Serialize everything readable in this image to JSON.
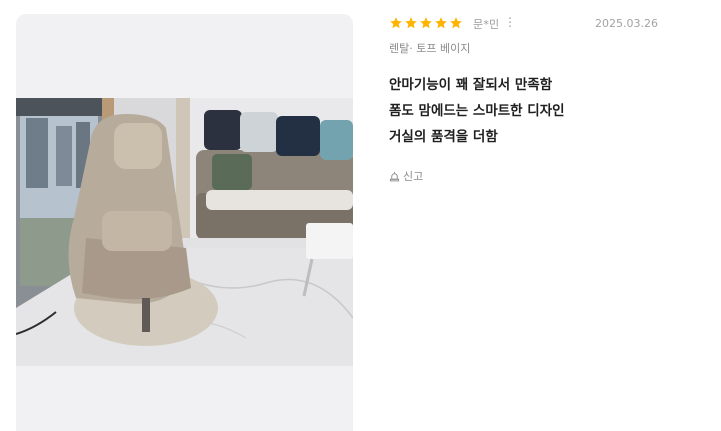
{
  "review": {
    "rating": 5,
    "rating_max": 5,
    "author": "문*민",
    "more_label": "⋮",
    "date": "2025.03.26",
    "option": "렌탈· 토프 베이지",
    "content_lines": [
      "안마기능이 꽤 잘되서 만족함",
      "폼도 맘에드는 스마트한 디자인",
      "거실의 품격을 더함"
    ],
    "report_label": "신고"
  },
  "colors": {
    "star": "#ffb400",
    "photo_bg": "#f1f1f3"
  },
  "icons": {
    "star": "star-icon",
    "more": "kebab-icon",
    "report": "siren-icon"
  }
}
